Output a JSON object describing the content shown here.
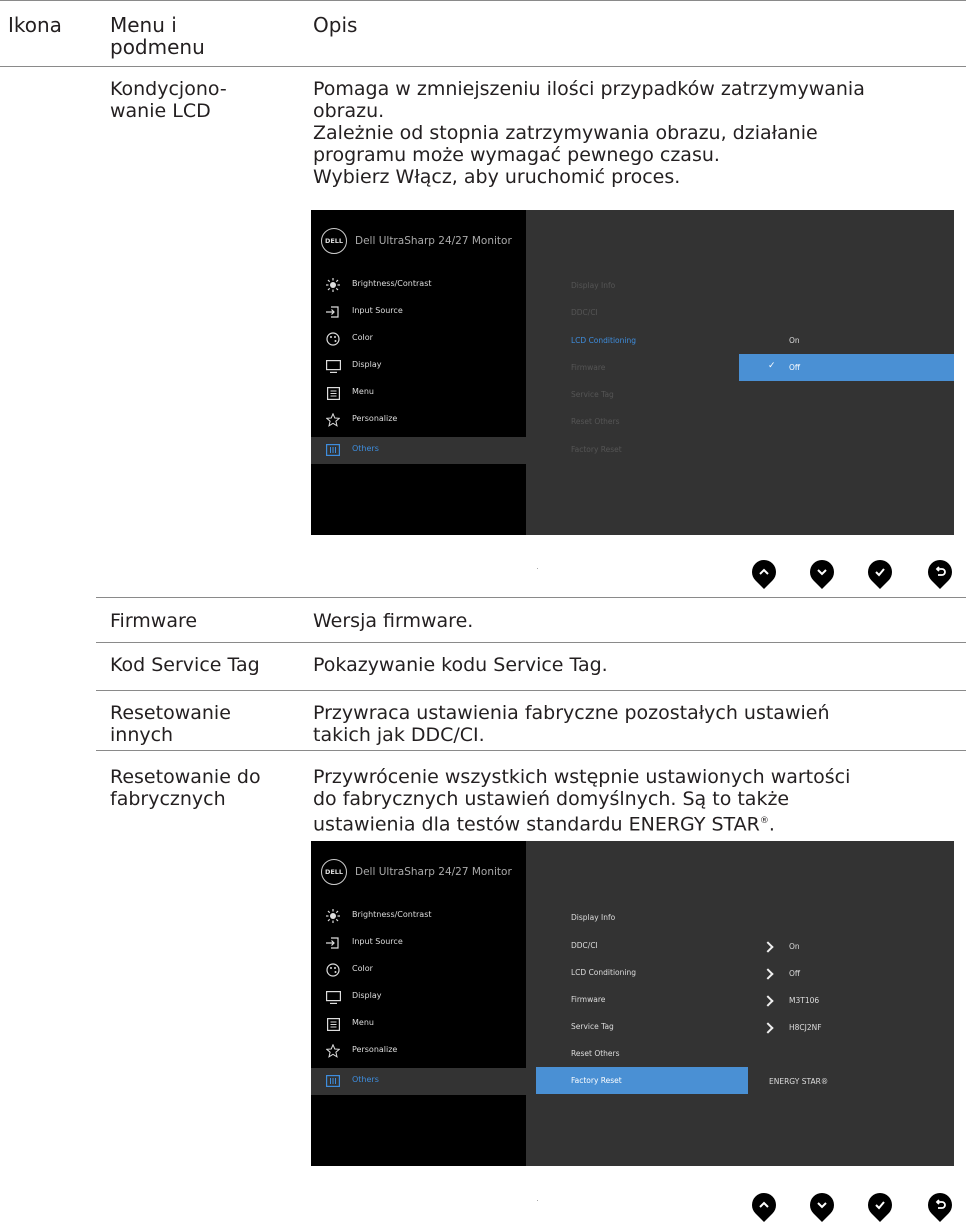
{
  "header": {
    "col_icon": "Ikona",
    "col_menu": "Menu i\npodmenu",
    "col_desc": "Opis"
  },
  "rows": {
    "lcd": {
      "name": "Kondycjono-\nwanie LCD",
      "desc": "Pomaga w zmniejszeniu ilości przypadków zatrzymywania\nobrazu.\nZależnie od stopnia zatrzymywania obrazu, działanie\nprogramu może wymagać pewnego czasu.\nWybierz Włącz, aby uruchomić proces."
    },
    "firmware": {
      "name": "Firmware",
      "desc": "Wersja firmware."
    },
    "service_tag": {
      "name": "Kod Service Tag",
      "desc": "Pokazywanie kodu Service Tag."
    },
    "reset_others": {
      "name": "Resetowanie\ninnych",
      "desc": "Przywraca ustawienia fabryczne pozostałych ustawień\ntakich jak DDC/CI."
    },
    "factory_reset": {
      "name": "Resetowanie do\nfabrycznych",
      "desc": "Przywrócenie wszystkich wstępnie ustawionych wartości\ndo fabrycznych ustawień domyślnych. Są to także\nustawienia dla testów standardu ENERGY STAR",
      "desc_sup": "®",
      "desc_end": "."
    }
  },
  "osd1": {
    "brand": "DELL",
    "title": "Dell UltraSharp 24/27 Monitor",
    "left_items": [
      {
        "label": "Brightness/Contrast",
        "icon": "brightness-icon"
      },
      {
        "label": "Input Source",
        "icon": "input-source-icon"
      },
      {
        "label": "Color",
        "icon": "color-palette-icon"
      },
      {
        "label": "Display",
        "icon": "display-icon"
      },
      {
        "label": "Menu",
        "icon": "menu-icon"
      },
      {
        "label": "Personalize",
        "icon": "star-icon"
      },
      {
        "label": "Others",
        "icon": "others-icon"
      }
    ],
    "right_items": [
      "Display Info",
      "DDC/CI",
      "LCD Conditioning",
      "Firmware",
      "Service Tag",
      "Reset Others",
      "Factory Reset"
    ],
    "options": [
      "On",
      "Off"
    ],
    "check": "✓"
  },
  "osd2": {
    "brand": "DELL",
    "title": "Dell UltraSharp 24/27 Monitor",
    "left_items": [
      {
        "label": "Brightness/Contrast",
        "icon": "brightness-icon"
      },
      {
        "label": "Input Source",
        "icon": "input-source-icon"
      },
      {
        "label": "Color",
        "icon": "color-palette-icon"
      },
      {
        "label": "Display",
        "icon": "display-icon"
      },
      {
        "label": "Menu",
        "icon": "menu-icon"
      },
      {
        "label": "Personalize",
        "icon": "star-icon"
      },
      {
        "label": "Others",
        "icon": "others-icon"
      }
    ],
    "right_items": [
      "Display Info",
      "DDC/CI",
      "LCD Conditioning",
      "Firmware",
      "Service Tag",
      "Reset Others",
      "Factory Reset"
    ],
    "values": {
      "ddc": "On",
      "lcd": "Off",
      "firmware": "M3T106",
      "service_tag": "H8CJ2NF",
      "factory_reset": "ENERGY STAR®"
    }
  },
  "buttons": [
    "up-button-icon",
    "down-button-icon",
    "confirm-button-icon",
    "back-button-icon"
  ],
  "colors": {
    "osd_left": "#000000",
    "osd_right": "#333333",
    "highlight": "#4a90d4",
    "accent": "#3e8ddd"
  }
}
